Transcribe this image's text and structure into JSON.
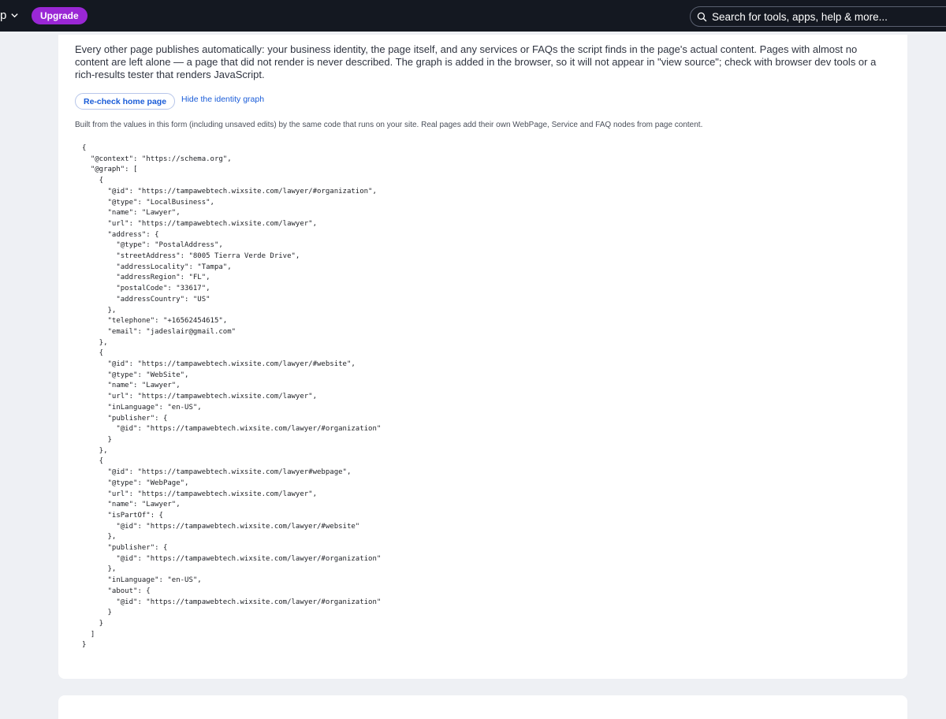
{
  "topbar": {
    "site_name": "p",
    "upgrade_label": "Upgrade",
    "search_placeholder": "Search for tools, apps, help & more..."
  },
  "identity": {
    "intro_text": "Every other page publishes automatically: your business identity, the page itself, and any services or FAQs the script finds in the page's actual content. Pages with almost no content are left alone — a page that did not render is never described. The graph is added in the browser, so it will not appear in \"view source\"; check with browser dev tools or a rich-results tester that renders JavaScript.",
    "recheck_label": "Re-check home page",
    "hide_graph_label": "Hide the identity graph",
    "built_note": "Built from the values in this form (including unsaved edits) by the same code that runs on your site. Real pages add their own WebPage, Service and FAQ nodes from page content.",
    "json_ld": "{\n  \"@context\": \"https://schema.org\",\n  \"@graph\": [\n    {\n      \"@id\": \"https://tampawebtech.wixsite.com/lawyer/#organization\",\n      \"@type\": \"LocalBusiness\",\n      \"name\": \"Lawyer\",\n      \"url\": \"https://tampawebtech.wixsite.com/lawyer\",\n      \"address\": {\n        \"@type\": \"PostalAddress\",\n        \"streetAddress\": \"8005 Tierra Verde Drive\",\n        \"addressLocality\": \"Tampa\",\n        \"addressRegion\": \"FL\",\n        \"postalCode\": \"33617\",\n        \"addressCountry\": \"US\"\n      },\n      \"telephone\": \"+16562454615\",\n      \"email\": \"jadeslair@gmail.com\"\n    },\n    {\n      \"@id\": \"https://tampawebtech.wixsite.com/lawyer/#website\",\n      \"@type\": \"WebSite\",\n      \"name\": \"Lawyer\",\n      \"url\": \"https://tampawebtech.wixsite.com/lawyer\",\n      \"inLanguage\": \"en-US\",\n      \"publisher\": {\n        \"@id\": \"https://tampawebtech.wixsite.com/lawyer/#organization\"\n      }\n    },\n    {\n      \"@id\": \"https://tampawebtech.wixsite.com/lawyer#webpage\",\n      \"@type\": \"WebPage\",\n      \"url\": \"https://tampawebtech.wixsite.com/lawyer\",\n      \"name\": \"Lawyer\",\n      \"isPartOf\": {\n        \"@id\": \"https://tampawebtech.wixsite.com/lawyer/#website\"\n      },\n      \"publisher\": {\n        \"@id\": \"https://tampawebtech.wixsite.com/lawyer/#organization\"\n      },\n      \"inLanguage\": \"en-US\",\n      \"about\": {\n        \"@id\": \"https://tampawebtech.wixsite.com/lawyer/#organization\"\n      }\n    }\n  ]\n}"
  },
  "icons": {
    "site_menu": "chevron-down-icon",
    "search": "search-icon"
  },
  "colors": {
    "topbar_bg": "#141821",
    "upgrade_bg": "#9a27d5",
    "link": "#1a5cd8",
    "page_bg": "#eef0f4"
  }
}
